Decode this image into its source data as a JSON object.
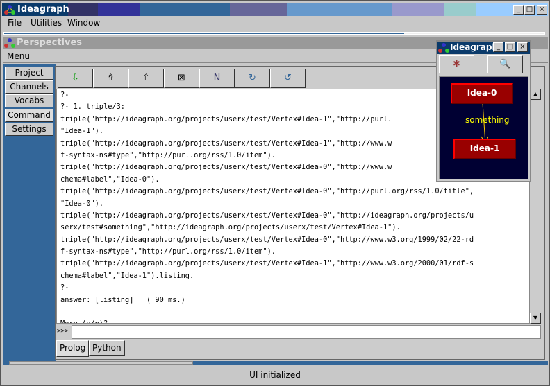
{
  "window": {
    "title": "Ideagraph",
    "controls": [
      "_",
      "□",
      "×"
    ]
  },
  "menubar": [
    "File",
    "Utilities",
    "Window"
  ],
  "progress": 0.74,
  "perspectives": {
    "title": "Perspectives",
    "menu": "Menu"
  },
  "sidebar": {
    "tabs": [
      "Project",
      "Channels",
      "Vocabs",
      "Command",
      "Settings"
    ],
    "selected": "Command"
  },
  "toolbar": {
    "icons": [
      "import-icon",
      "upload-stack-icon",
      "export-icon",
      "clear-icon",
      "download-n-icon",
      "refresh-graph-icon",
      "reload-icon"
    ]
  },
  "console": {
    "lines": [
      "?-",
      "?- 1. triple/3:",
      "triple(\"http://ideagraph.org/projects/userx/test/Vertex#Idea-1\",\"http://purl.",
      "\"Idea-1\").",
      "triple(\"http://ideagraph.org/projects/userx/test/Vertex#Idea-1\",\"http://www.w",
      "f-syntax-ns#type\",\"http://purl.org/rss/1.0/item\").",
      "triple(\"http://ideagraph.org/projects/userx/test/Vertex#Idea-0\",\"http://www.w",
      "chema#label\",\"Idea-0\").",
      "triple(\"http://ideagraph.org/projects/userx/test/Vertex#Idea-0\",\"http://purl.org/rss/1.0/title\",",
      "\"Idea-0\").",
      "triple(\"http://ideagraph.org/projects/userx/test/Vertex#Idea-0\",\"http://ideagraph.org/projects/u",
      "serx/test#something\",\"http://ideagraph.org/projects/userx/test/Vertex#Idea-1\").",
      "triple(\"http://ideagraph.org/projects/userx/test/Vertex#Idea-0\",\"http://www.w3.org/1999/02/22-rd",
      "f-syntax-ns#type\",\"http://purl.org/rss/1.0/item\").",
      "triple(\"http://ideagraph.org/projects/userx/test/Vertex#Idea-1\",\"http://www.w3.org/2000/01/rdf-s",
      "chema#label\",\"Idea-1\").listing.",
      "?-",
      "answer: [listing]   ( 90 ms.)",
      "",
      "More (y/n)?"
    ]
  },
  "input": {
    "prompt": ">>>",
    "value": ""
  },
  "bottom_tabs": [
    "Prolog",
    "Python"
  ],
  "status": "UI initialized",
  "graph_window": {
    "title": "Ideagraph",
    "nodes": [
      "Idea-0",
      "Idea-1"
    ],
    "edge_label": "something"
  }
}
